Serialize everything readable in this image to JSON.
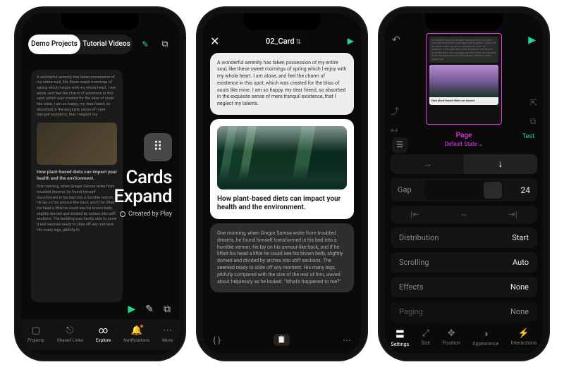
{
  "accent": "#1fd98a",
  "phone1": {
    "segments": {
      "a": "Demo Projects",
      "b": "Tutorial Videos"
    },
    "card": {
      "paragraph1": "A wonderful serenity has taken possession of my entire soul, like these sweet mornings of spring which I enjoy with my whole heart. I am alone, and feel the charm of existence in this spot, which was created for the bliss of souls like mine. I am so happy, my dear friend, so absorbed in the exquisite sense of mere tranquil existence, that I neglect my",
      "headline": "How plant-based diets can impact your health and the environment.",
      "paragraph2": "One morning, when Gregor Samsa woke from troubled dreams, he found himself transformed in his bed into a horrible vermin. He lay on his armour-like back, and if he lifted his head a little he could see his brown belly, slightly domed and divided by arches into stiff sections. The bedding was hardly able to cover it and seemed ready to slide off any moment. His many legs, pitifully th"
    },
    "title_line1": "Cards",
    "title_line2": "Expand",
    "byline": "Created by Play",
    "tabs": {
      "projects": "Projects",
      "shared": "Shared Links",
      "explore": "Explore",
      "notifications": "Notifications",
      "more": "More"
    }
  },
  "phone2": {
    "title": "02_Card",
    "card1_text": "A wonderful serenity has taken possession of my entire soul, like these sweet mornings of spring which I enjoy with my whole heart. I am alone, and feel the charm of existence in this spot, which was created for the bliss of souls like mine. I am so happy, my dear friend, so absorbed in the exquisite sense of mere tranquil existence, that I neglect my talents.",
    "card2_headline": "How plant-based diets can impact your health and the environment.",
    "card3_text": "One morning, when Gregor Samsa woke from troubled dreams, he found himself transformed in his bed into a horrible vermin. He lay on his armour-like back, and if he lifted his head a little he could see his brown belly, slightly domed and divided by arches into stiff sections. The seemed ready to slide off any moment. His many legs, pitifully compared with the size of the rest of him, waved about helplessly as he looked. \"What's happened to me?\""
  },
  "phone3": {
    "preview_para": "A wonderful serenity has taken possession of my entire soul, like these sweet mornings of spring which I enjoy with my whole heart. I am alone, and feel the charm of existence in this spot, which was created for the bliss of souls like mine. I am so happy, my dear friend, so absorbed in the exquisite sense of mere tranquil existence, that I neglect my",
    "preview_headline": "How plant-based diets can impact",
    "page_name": "Page",
    "page_state": "Default State",
    "test_label": "Test",
    "gap_label": "Gap",
    "gap_value": "24",
    "rows": {
      "distribution": {
        "label": "Distribution",
        "value": "Start"
      },
      "scrolling": {
        "label": "Scrolling",
        "value": "Auto"
      },
      "effects": {
        "label": "Effects",
        "value": "None"
      },
      "paging": {
        "label": "Paging",
        "value": "None"
      }
    },
    "tabs": {
      "settings": "Settings",
      "size": "Size",
      "position": "Position",
      "appearance": "Appearance",
      "interactions": "Interactions"
    }
  }
}
